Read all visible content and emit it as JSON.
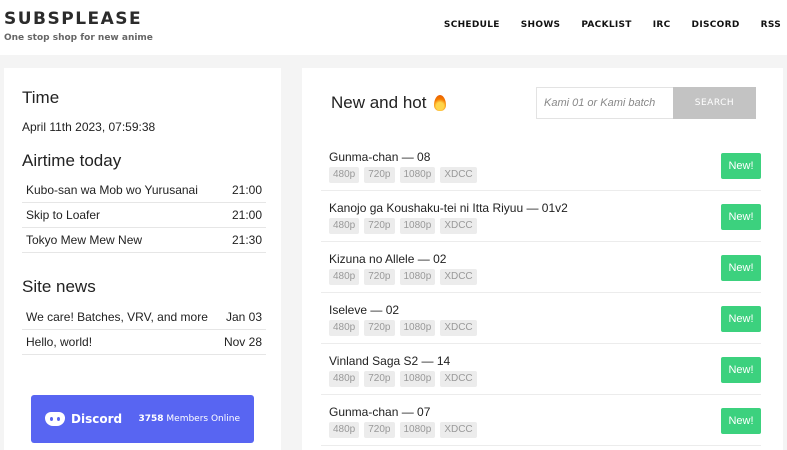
{
  "header": {
    "title": "SUBSPLEASE",
    "tagline": "One stop shop for new anime",
    "nav": [
      "SCHEDULE",
      "SHOWS",
      "PACKLIST",
      "IRC",
      "DISCORD",
      "RSS"
    ]
  },
  "time": {
    "heading": "Time",
    "value": "April 11th 2023, 07:59:38"
  },
  "airtime": {
    "heading": "Airtime today",
    "items": [
      {
        "title": "Kubo-san wa Mob wo Yurusanai",
        "time": "21:00"
      },
      {
        "title": "Skip to Loafer",
        "time": "21:00"
      },
      {
        "title": "Tokyo Mew Mew New",
        "time": "21:30"
      }
    ]
  },
  "news": {
    "heading": "Site news",
    "items": [
      {
        "title": "We care! Batches, VRV, and more",
        "date": "Jan 03"
      },
      {
        "title": "Hello, world!",
        "date": "Nov 28"
      }
    ]
  },
  "discord": {
    "name": "Discord",
    "count": "3758",
    "suffix": "Members Online"
  },
  "releases": {
    "heading": "New and hot",
    "search_placeholder": "Kami 01 or Kami batch",
    "search_button": "SEARCH",
    "tags": [
      "480p",
      "720p",
      "1080p",
      "XDCC"
    ],
    "new_label": "New!",
    "items": [
      "Gunma-chan — 08",
      "Kanojo ga Koushaku-tei ni Itta Riyuu — 01v2",
      "Kizuna no Allele — 02",
      "Iseleve — 02",
      "Vinland Saga S2 — 14",
      "Gunma-chan — 07"
    ]
  },
  "colors": {
    "accent_green": "#3cd17e",
    "discord": "#5865f2"
  }
}
